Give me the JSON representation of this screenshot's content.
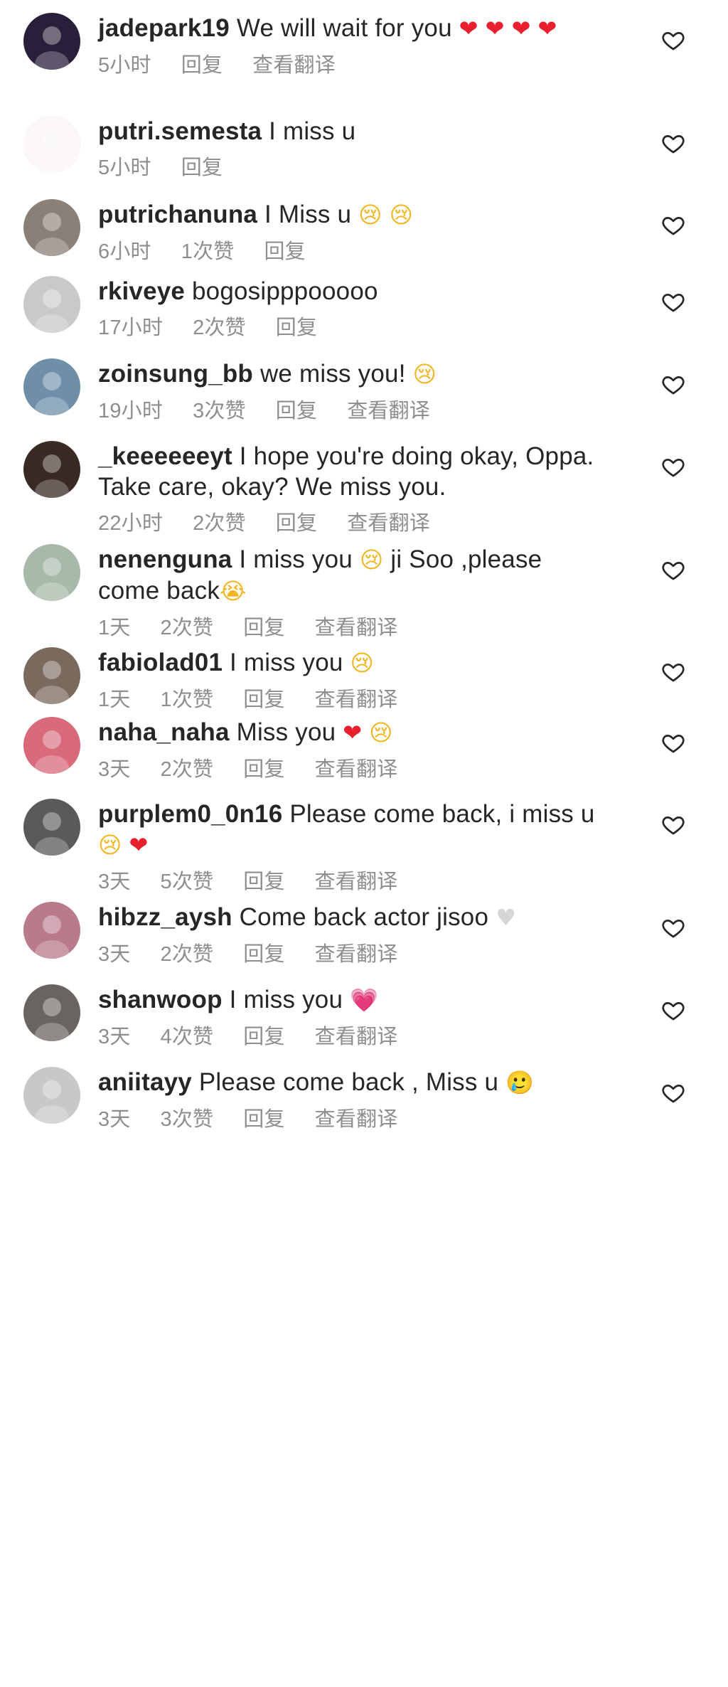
{
  "comments": [
    {
      "username": "jadepark19",
      "text": "We will wait for you",
      "emoji": [
        "❤",
        "❤",
        "❤",
        "❤"
      ],
      "emoji_style": [
        "red",
        "red",
        "red",
        "red"
      ],
      "time": "5小时",
      "likes": "",
      "reply": "回复",
      "translate": "查看翻译",
      "avatar_color": "#2a1f3a"
    },
    {
      "username": "putri.semesta",
      "text": "I miss u",
      "emoji": [],
      "emoji_style": [],
      "time": "5小时",
      "likes": "",
      "reply": "回复",
      "translate": "",
      "avatar_color": "#fbf6f8"
    },
    {
      "username": "putrichanuna",
      "text": "I Miss u",
      "emoji": [
        "😢",
        "😢"
      ],
      "emoji_style": [
        "cry",
        "cry"
      ],
      "time": "6小时",
      "likes": "1次赞",
      "reply": "回复",
      "translate": "",
      "avatar_color": "#8a8078"
    },
    {
      "username": "rkiveye",
      "text": "bogosipppooooo",
      "emoji": [],
      "emoji_style": [],
      "time": "17小时",
      "likes": "2次赞",
      "reply": "回复",
      "translate": "",
      "avatar_color": "#c9c9c9"
    },
    {
      "username": "zoinsung_bb",
      "text": "we miss you!",
      "emoji": [
        "😢"
      ],
      "emoji_style": [
        "cry"
      ],
      "time": "19小时",
      "likes": "3次赞",
      "reply": "回复",
      "translate": "查看翻译",
      "avatar_color": "#6f8fa8"
    },
    {
      "username": "_keeeeeeyt",
      "text": "I hope you're doing okay, Oppa. Take care, okay? We miss you.",
      "emoji": [],
      "emoji_style": [],
      "time": "22小时",
      "likes": "2次赞",
      "reply": "回复",
      "translate": "查看翻译",
      "avatar_color": "#3a2a24"
    },
    {
      "username": "nenenguna",
      "text": "I miss you",
      "text2": " ji Soo ,please come back",
      "emoji": [
        "😢"
      ],
      "emoji2": [
        "😭"
      ],
      "emoji_style": [
        "cry"
      ],
      "time": "1天",
      "likes": "2次赞",
      "reply": "回复",
      "translate": "查看翻译",
      "avatar_color": "#a7b9a8"
    },
    {
      "username": "fabiolad01",
      "text": "I miss you",
      "emoji": [
        "😢"
      ],
      "emoji_style": [
        "cry"
      ],
      "time": "1天",
      "likes": "1次赞",
      "reply": "回复",
      "translate": "查看翻译",
      "avatar_color": "#7a6a5e"
    },
    {
      "username": "naha_naha",
      "text": "Miss you",
      "emoji": [
        "❤",
        "😢"
      ],
      "emoji_style": [
        "red",
        "cry"
      ],
      "time": "3天",
      "likes": "2次赞",
      "reply": "回复",
      "translate": "查看翻译",
      "avatar_color": "#d96a7a"
    },
    {
      "username": "purplem0_0n16",
      "text": "Please come back, i miss u",
      "emoji": [
        "😢",
        "❤"
      ],
      "emoji_style": [
        "cry",
        "red"
      ],
      "time": "3天",
      "likes": "5次赞",
      "reply": "回复",
      "translate": "查看翻译",
      "avatar_color": "#5a5a5a"
    },
    {
      "username": "hibzz_aysh",
      "text": "Come back actor jisoo",
      "emoji": [
        "♥"
      ],
      "emoji_style": [
        "white"
      ],
      "time": "3天",
      "likes": "2次赞",
      "reply": "回复",
      "translate": "查看翻译",
      "avatar_color": "#b97a8a"
    },
    {
      "username": "shanwoop",
      "text": "I miss you",
      "emoji": [
        "💗"
      ],
      "emoji_style": [
        "pink"
      ],
      "time": "3天",
      "likes": "4次赞",
      "reply": "回复",
      "translate": "查看翻译",
      "avatar_color": "#6a6460"
    },
    {
      "username": "aniitayy",
      "text": "Please come back , Miss u",
      "emoji": [
        "🥲"
      ],
      "emoji_style": [
        "cry"
      ],
      "time": "3天",
      "likes": "3次赞",
      "reply": "回复",
      "translate": "查看翻译",
      "avatar_color": "#c7c9c7"
    }
  ],
  "colors": {
    "text": "#262626",
    "meta": "#8e8e8e",
    "heart_outline": "#262626"
  }
}
